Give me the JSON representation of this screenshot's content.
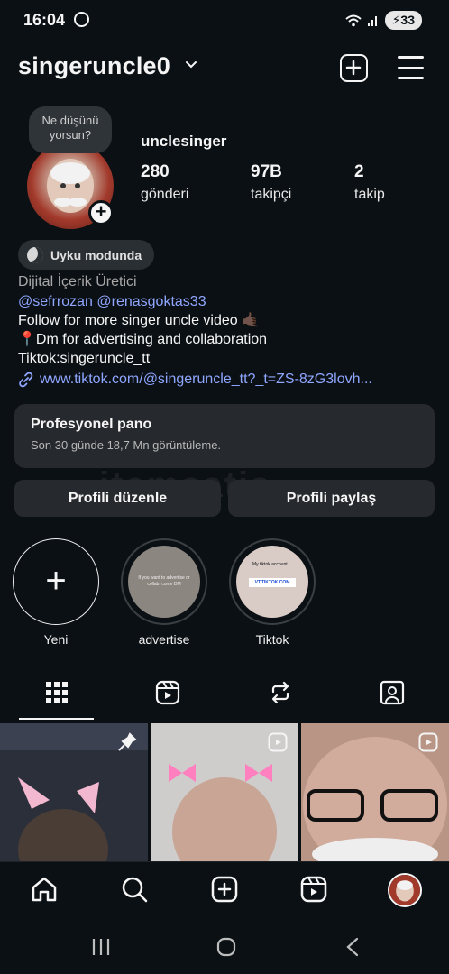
{
  "status_bar": {
    "time": "16:04",
    "battery": "33"
  },
  "header": {
    "username": "singeruncle0"
  },
  "profile": {
    "note_bubble": "Ne düşünü yorsun?",
    "display_name": "unclesinger",
    "stats": [
      {
        "value": "280",
        "label": "gönderi"
      },
      {
        "value": "97B",
        "label": "takipçi"
      },
      {
        "value": "2",
        "label": "takip"
      }
    ],
    "sleep_status": "Uyku modunda",
    "category": "Dijital İçerik Üretici",
    "mentions": "@sefrrozan @renasgoktas33",
    "bio_line1": "Follow for more singer uncle video 🤙🏿",
    "bio_line2": "📍Dm for advertising and collaboration",
    "bio_line3": "Tiktok:singeruncle_tt",
    "link": "www.tiktok.com/@singeruncle_tt?_t=ZS-8zG3lovh..."
  },
  "pro_dashboard": {
    "title": "Profesyonel pano",
    "subtitle": "Son 30 günde 18,7 Mn görüntüleme."
  },
  "watermark": "itemsatis",
  "buttons": {
    "edit": "Profili düzenle",
    "share": "Profili paylaş"
  },
  "highlights": [
    {
      "label": "Yeni",
      "cover_text": ""
    },
    {
      "label": "advertise",
      "cover_text": "If you want to advertise or collab, come DM"
    },
    {
      "label": "Tiktok",
      "cover_text": "My tiktok account",
      "cover_badge": "VT.TIKTOK.COM"
    }
  ],
  "tabs": [
    "grid-icon",
    "reels-icon",
    "reposts-icon",
    "tagged-icon"
  ],
  "nav": [
    "home-icon",
    "search-icon",
    "create-icon",
    "reels-icon",
    "profile-avatar"
  ],
  "colors": {
    "background": "#0b1014",
    "surface": "#26292d",
    "link": "#8fa6ff"
  }
}
